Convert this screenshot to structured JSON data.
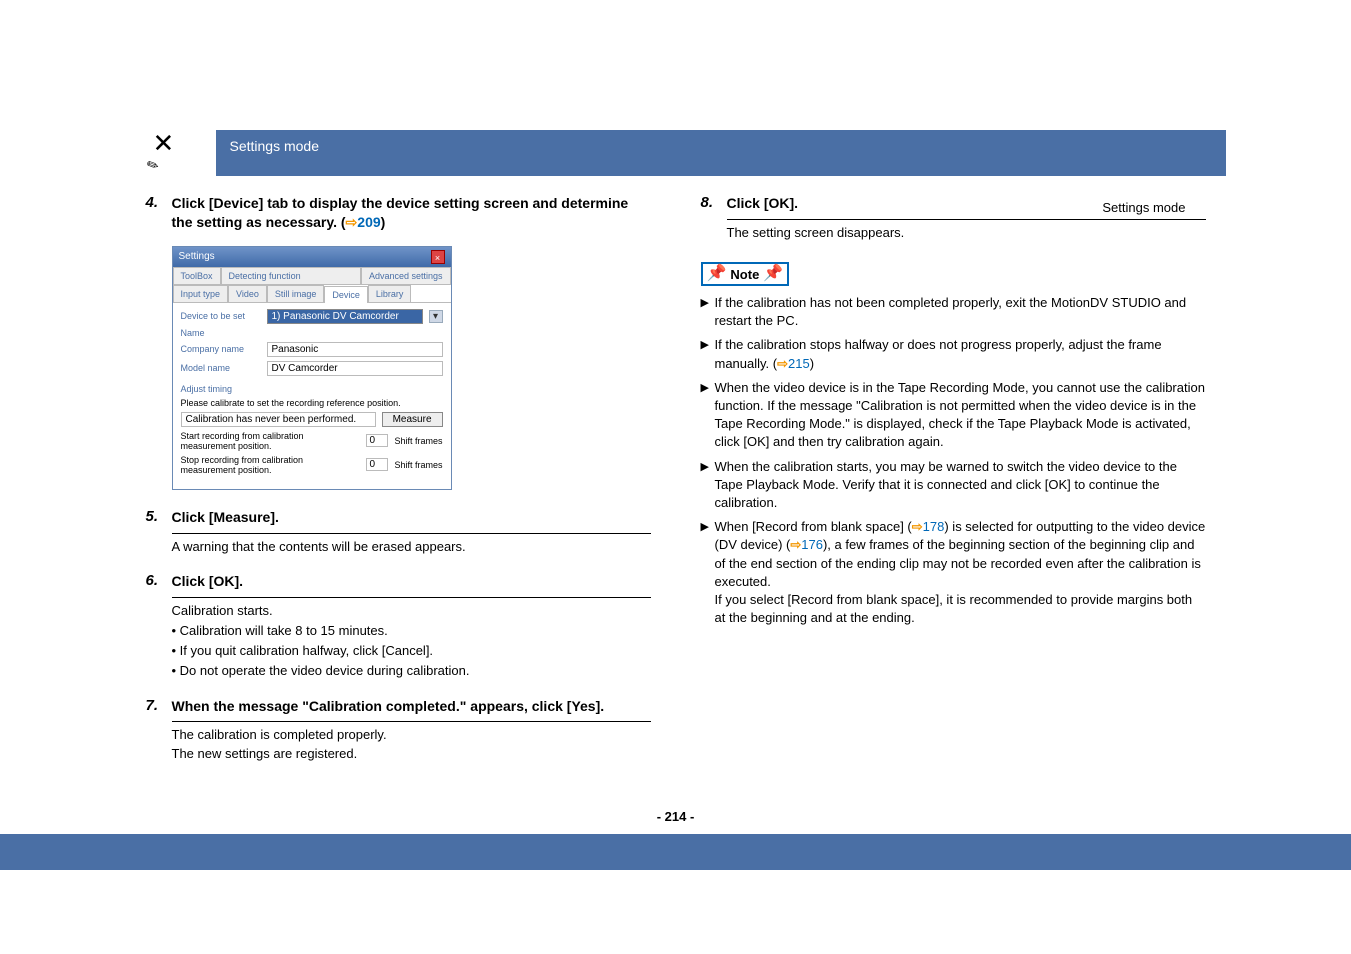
{
  "breadcrumb_top": "Settings mode",
  "header_band": "Settings mode",
  "left": {
    "step4": {
      "num": "4.",
      "title_pre": "Click [Device] tab to display the device setting screen and determine the setting as necessary. (",
      "link": "209",
      "title_post": ")"
    },
    "dialog": {
      "title": "Settings",
      "tabs_row2": [
        "ToolBox",
        "Detecting function",
        "Advanced settings"
      ],
      "tabs_row1": [
        "Input type",
        "Video",
        "Still image",
        "Device",
        "Library"
      ],
      "active_tab": "Device",
      "device_to_be_set_label": "Device to be set",
      "device_to_be_set_value": "1) Panasonic DV Camcorder",
      "name_section": "Name",
      "company_label": "Company name",
      "company_value": "Panasonic",
      "model_label": "Model name",
      "model_value": "DV Camcorder",
      "adjust_section": "Adjust timing",
      "adjust_hint": "Please calibrate to set the recording reference position.",
      "calibration_status": "Calibration has never been performed.",
      "measure_btn": "Measure",
      "start_label": "Start recording from calibration measurement position.",
      "stop_label": "Stop recording from calibration measurement position.",
      "start_val": "0",
      "stop_val": "0",
      "shift_frames": "Shift frames"
    },
    "step5": {
      "num": "5.",
      "title": "Click [Measure].",
      "body": "A warning that the contents will be erased appears."
    },
    "step6": {
      "num": "6.",
      "title": "Click [OK].",
      "body1": "Calibration starts.",
      "bullet1": "• Calibration will take 8 to 15 minutes.",
      "bullet2": "• If you quit calibration halfway, click [Cancel].",
      "bullet3": "• Do not operate the video device during calibration."
    },
    "step7": {
      "num": "7.",
      "title": "When the message \"Calibration completed.\" appears, click [Yes].",
      "body1": "The calibration is completed properly.",
      "body2": "The new settings are registered."
    }
  },
  "right": {
    "step8": {
      "num": "8.",
      "title": "Click [OK].",
      "body": "The setting screen disappears."
    },
    "note_label": "Note",
    "notes": {
      "n1": "If the calibration has not been completed properly, exit the MotionDV STUDIO and restart the PC.",
      "n2_pre": "If the calibration stops halfway or does not progress properly, adjust the frame manually. (",
      "n2_link": "215",
      "n2_post": ")",
      "n3": "When the video device is in the Tape Recording Mode, you cannot use the calibration function. If the message \"Calibration is not permitted when the video device is in the Tape Recording Mode.\" is displayed, check if the Tape Playback Mode is activated, click [OK] and then try calibration again.",
      "n4": "When the calibration starts, you may be warned to switch the video device to the Tape Playback Mode. Verify that it is connected and click [OK] to continue the calibration.",
      "n5_a": "When [Record from blank space] (",
      "n5_link1": "178",
      "n5_b": ") is selected for outputting to the video device (DV device) (",
      "n5_link2": "176",
      "n5_c": "), a few frames of the beginning section of the beginning clip and of the end section of the ending clip may not be recorded even after the calibration is executed.",
      "n5_d": "If you select [Record from blank space], it is recommended to provide margins both at the beginning and at the ending."
    }
  },
  "page_number": "- 214 -"
}
